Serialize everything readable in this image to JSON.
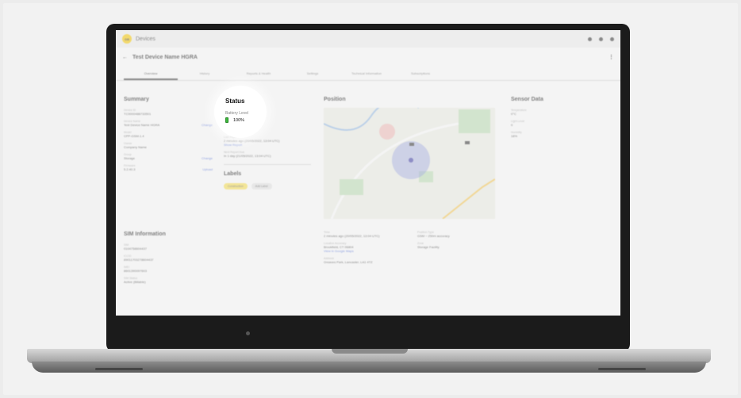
{
  "topbar": {
    "logo_text": "GB",
    "app_title": "Devices"
  },
  "titlebar": {
    "back": "←",
    "device_name": "Test Device Name HGRA"
  },
  "tabs": [
    "Overview",
    "History",
    "Reports & Health",
    "Settings",
    "Technical Information",
    "Subscriptions"
  ],
  "summary": {
    "heading": "Summary",
    "fields": [
      {
        "label": "Device ID",
        "value": "TC0000488733501"
      },
      {
        "label": "Device Name",
        "value": "Test Device Name HGRA",
        "action": "Change"
      },
      {
        "label": "Model",
        "value": "CPP-GSM-1.4"
      },
      {
        "label": "Owner",
        "value": "Company Name"
      },
      {
        "label": "Group",
        "value": "Storage",
        "action": "Change"
      },
      {
        "label": "Firmware",
        "value": "5.2.40.3",
        "action": "Upload"
      }
    ]
  },
  "sim": {
    "heading": "SIM Information",
    "fields": [
      {
        "label": "SIM",
        "value": "0104758604437"
      },
      {
        "label": "ICCID",
        "value": "89011703278604437"
      },
      {
        "label": "IMEI",
        "value": "8601390097603"
      },
      {
        "label": "SIM Status",
        "value": "Active (Billable)"
      }
    ]
  },
  "status": {
    "heading": "Status",
    "battery_label": "Battery Level",
    "battery_value": "100%",
    "last_report_label": "Last Report",
    "last_report_value": "2 minutes ago (20/05/2022, 13:04 UTC)",
    "show_report": "Show Report",
    "next_report_label": "Next Report Due",
    "next_report_value": "In 1 day (21/05/2022, 13:04 UTC)"
  },
  "labels": {
    "heading": "Labels",
    "chips": [
      "Construction",
      "Add Label"
    ]
  },
  "position": {
    "heading": "Position",
    "time_label": "Time",
    "time_value": "2 minutes ago (20/05/2022, 13:04 UTC)",
    "location_label": "Location Accuracy",
    "location_value": "Brookfield, CT 06804",
    "maps_link": "View in Google Maps",
    "address_label": "Address",
    "address_value": "Greaves Park, Lancaster, LA1 4TZ",
    "position_type_label": "Position Type",
    "position_type_value": "GSM  ~ 250m accuracy",
    "zone_label": "Zone",
    "zone_value": "Storage Facility"
  },
  "sensor": {
    "heading": "Sensor Data",
    "items": [
      {
        "label": "Temperature",
        "value": "0°C"
      },
      {
        "label": "Light Level",
        "value": "0"
      },
      {
        "label": "Humidity",
        "value": "18%"
      }
    ]
  }
}
